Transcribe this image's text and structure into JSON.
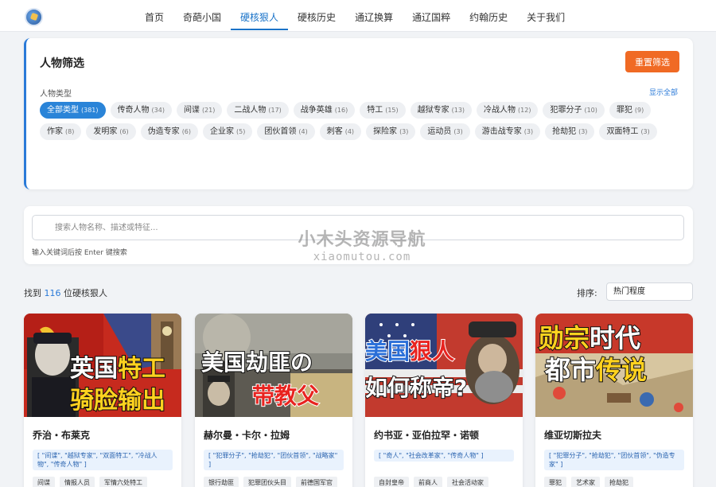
{
  "nav": {
    "items": [
      "首页",
      "奇葩小国",
      "硬核狠人",
      "硬核历史",
      "通辽换算",
      "通辽国粹",
      "约翰历史",
      "关于我们"
    ],
    "active_index": 2
  },
  "filter": {
    "title": "人物筛选",
    "reset_label": "重置筛选",
    "type_label": "人物类型",
    "show_all": "显示全部",
    "chips": [
      {
        "label": "全部类型",
        "count": "(381)",
        "active": true
      },
      {
        "label": "传奇人物",
        "count": "(34)"
      },
      {
        "label": "间谍",
        "count": "(21)"
      },
      {
        "label": "二战人物",
        "count": "(17)"
      },
      {
        "label": "战争英雄",
        "count": "(16)"
      },
      {
        "label": "特工",
        "count": "(15)"
      },
      {
        "label": "越狱专家",
        "count": "(13)"
      },
      {
        "label": "冷战人物",
        "count": "(12)"
      },
      {
        "label": "犯罪分子",
        "count": "(10)"
      },
      {
        "label": "罪犯",
        "count": "(9)"
      },
      {
        "label": "作家",
        "count": "(8)"
      },
      {
        "label": "发明家",
        "count": "(6)"
      },
      {
        "label": "伪造专家",
        "count": "(6)"
      },
      {
        "label": "企业家",
        "count": "(5)"
      },
      {
        "label": "团伙首领",
        "count": "(4)"
      },
      {
        "label": "刺客",
        "count": "(4)"
      },
      {
        "label": "探险家",
        "count": "(3)"
      },
      {
        "label": "运动员",
        "count": "(3)"
      },
      {
        "label": "游击战专家",
        "count": "(3)"
      },
      {
        "label": "抢劫犯",
        "count": "(3)"
      },
      {
        "label": "双面特工",
        "count": "(3)"
      }
    ]
  },
  "search": {
    "placeholder": "搜索人物名称、描述或特征...",
    "hint": "输入关键词后按 Enter 键搜索"
  },
  "watermark": {
    "line1": "小木头资源导航",
    "line2": "xiaomutou.com"
  },
  "results": {
    "prefix": "找到 ",
    "count": "116",
    "suffix": " 位硬核狠人"
  },
  "sort": {
    "label": "排序:",
    "value": "热门程度"
  },
  "cards": [
    {
      "thumb_line1": [
        "英国",
        "特工"
      ],
      "thumb_line2": "骑脸输出",
      "name": "乔治・布莱克",
      "tags": "[ \"间谍\", \"越狱专家\", \"双面特工\", \"冷战人物\", \"传奇人物\" ]",
      "attrs": [
        "间谍",
        "情报人员",
        "军情六处特工"
      ]
    },
    {
      "thumb_line1": [
        "美国劫匪",
        "の"
      ],
      "thumb_line2": "带教父",
      "name": "赫尔曼・卡尔・拉姆",
      "tags": "[ \"犯罪分子\", \"抢劫犯\", \"团伙首领\", \"战略家\" ]",
      "attrs": [
        "银行劫匪",
        "犯罪团伙头目",
        "前德国军官"
      ]
    },
    {
      "thumb_line1": [
        "美国",
        "狠人"
      ],
      "thumb_line2": "如何称帝?",
      "name": "约书亚・亚伯拉罕・诺顿",
      "tags": "[ \"奇人\", \"社会改革家\", \"传奇人物\" ]",
      "attrs": [
        "自封皇帝",
        "前商人",
        "社会活动家"
      ]
    },
    {
      "thumb_line1": [
        "勋宗",
        "时代"
      ],
      "thumb_line2": [
        "都市",
        "传说"
      ],
      "name": "维亚切斯拉夫",
      "tags": "[ \"犯罪分子\", \"抢劫犯\", \"团伙首领\", \"伪造专家\" ]",
      "attrs": [
        "罪犯",
        "艺术家",
        "抢劫犯"
      ]
    }
  ],
  "colors": {
    "accent": "#1a73c8",
    "reset": "#f06a24",
    "thumb_yellow": "#ffd21f",
    "thumb_red": "#e8231f"
  }
}
